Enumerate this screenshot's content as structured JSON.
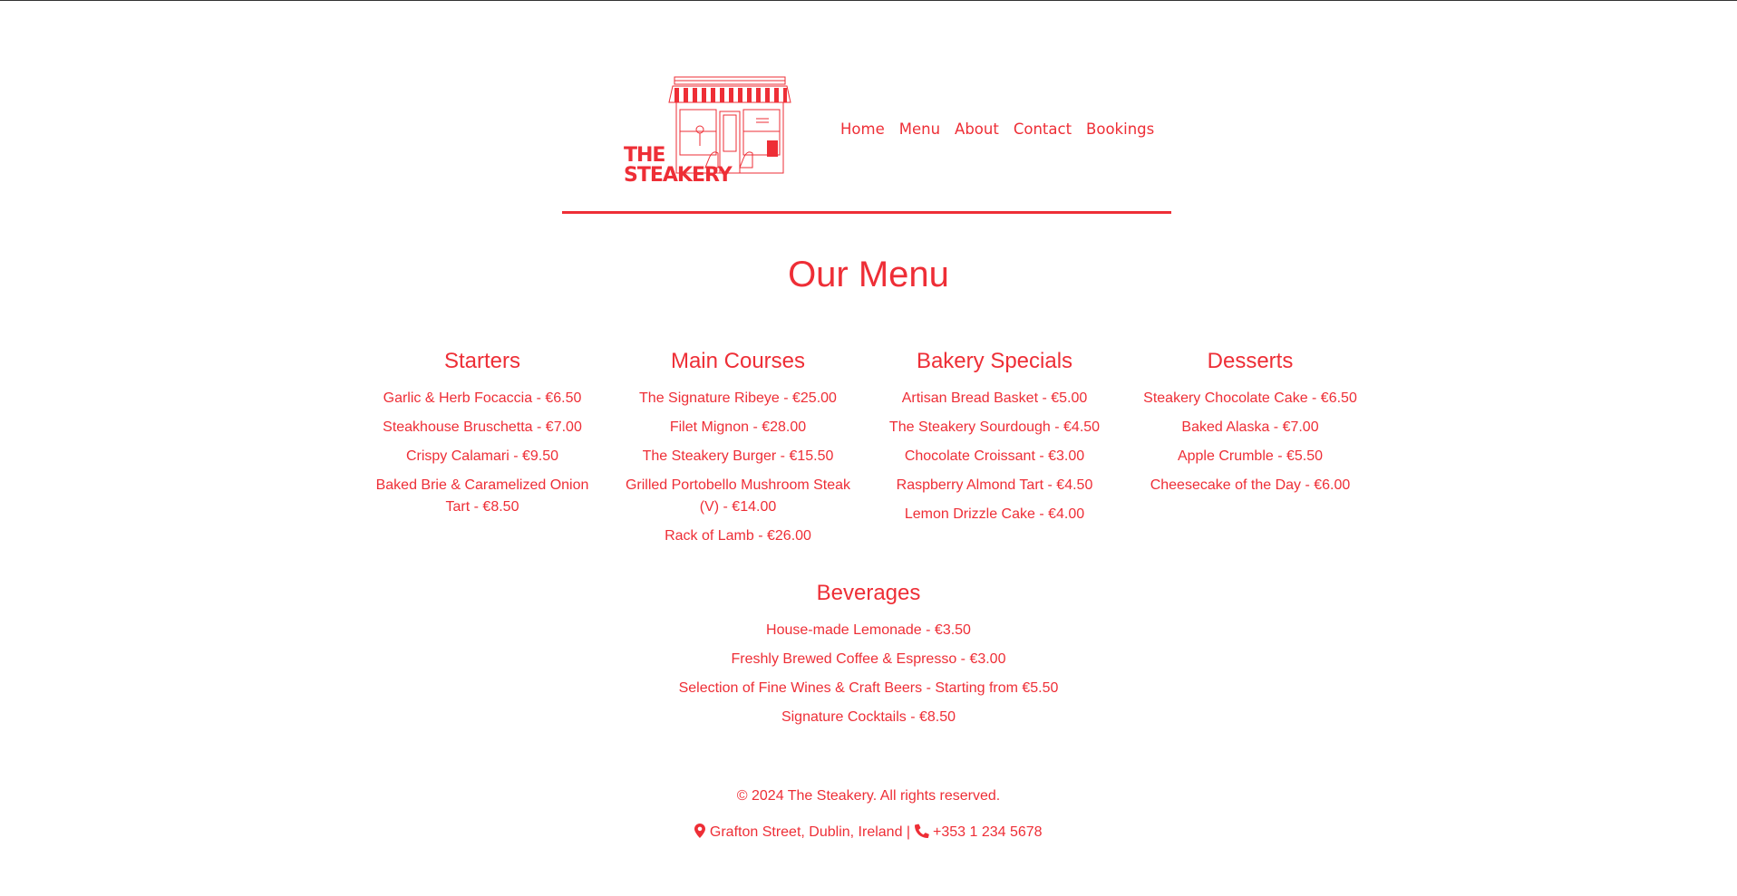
{
  "brand": {
    "logo_line1": "THE",
    "logo_line2": "STEAKERY"
  },
  "nav": {
    "items": [
      "Home",
      "Menu",
      "About",
      "Contact",
      "Bookings"
    ]
  },
  "page_title": "Our Menu",
  "menu": {
    "starters": {
      "title": "Starters",
      "items": [
        "Garlic & Herb Focaccia - €6.50",
        "Steakhouse Bruschetta - €7.00",
        "Crispy Calamari - €9.50",
        "Baked Brie & Caramelized Onion Tart - €8.50"
      ]
    },
    "mains": {
      "title": "Main Courses",
      "items": [
        "The Signature Ribeye - €25.00",
        "Filet Mignon - €28.00",
        "The Steakery Burger - €15.50",
        "Grilled Portobello Mushroom Steak (V) - €14.00",
        "Rack of Lamb - €26.00"
      ]
    },
    "bakery": {
      "title": "Bakery Specials",
      "items": [
        "Artisan Bread Basket - €5.00",
        "The Steakery Sourdough - €4.50",
        "Chocolate Croissant - €3.00",
        "Raspberry Almond Tart - €4.50",
        "Lemon Drizzle Cake - €4.00"
      ]
    },
    "desserts": {
      "title": "Desserts",
      "items": [
        "Steakery Chocolate Cake - €6.50",
        "Baked Alaska - €7.00",
        "Apple Crumble - €5.50",
        "Cheesecake of the Day - €6.00"
      ]
    },
    "beverages": {
      "title": "Beverages",
      "items": [
        "House-made Lemonade - €3.50",
        "Freshly Brewed Coffee & Espresso - €3.00",
        "Selection of Fine Wines & Craft Beers - Starting from €5.50",
        "Signature Cocktails - €8.50"
      ]
    }
  },
  "footer": {
    "copyright": "© 2024 The Steakery. All rights reserved.",
    "address": "Grafton Street, Dublin, Ireland",
    "separator": "|",
    "phone": "+353 1 234 5678"
  },
  "colors": {
    "accent": "#ee2e36",
    "background": "#ffffff"
  },
  "icons": {
    "address": "map-marker-icon",
    "phone": "phone-icon"
  }
}
